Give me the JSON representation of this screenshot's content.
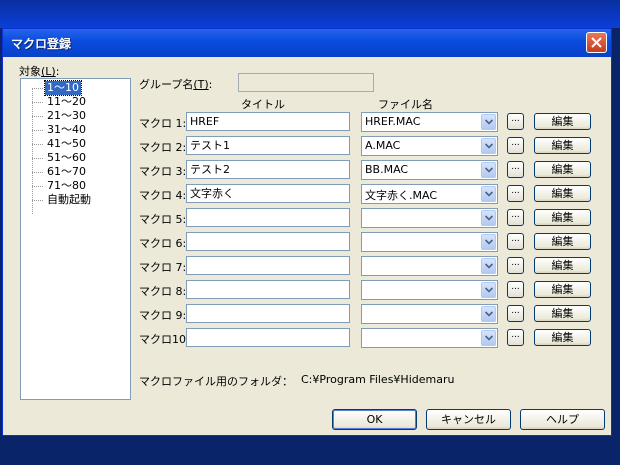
{
  "window": {
    "title": "マクロ登録"
  },
  "target": {
    "label": "対象",
    "accel": "(L)",
    "colon": ":",
    "items": [
      "1～10",
      "11～20",
      "21～30",
      "31～40",
      "41～50",
      "51～60",
      "61～70",
      "71～80",
      "自動起動"
    ],
    "selected": "1～10"
  },
  "group": {
    "label": "グループ名",
    "accel": "(T)",
    "colon": ":",
    "value": ""
  },
  "headers": {
    "title": "タイトル",
    "file": "ファイル名"
  },
  "macros": [
    {
      "label": "マクロ 1:",
      "title": "HREF",
      "file": "HREF.MAC"
    },
    {
      "label": "マクロ 2:",
      "title": "テスト1",
      "file": "A.MAC"
    },
    {
      "label": "マクロ 3:",
      "title": "テスト2",
      "file": "BB.MAC"
    },
    {
      "label": "マクロ 4:",
      "title": "文字赤く",
      "file": "文字赤く.MAC"
    },
    {
      "label": "マクロ 5:",
      "title": "",
      "file": ""
    },
    {
      "label": "マクロ 6:",
      "title": "",
      "file": ""
    },
    {
      "label": "マクロ 7:",
      "title": "",
      "file": ""
    },
    {
      "label": "マクロ 8:",
      "title": "",
      "file": ""
    },
    {
      "label": "マクロ 9:",
      "title": "",
      "file": ""
    },
    {
      "label": "マクロ10:",
      "title": "",
      "file": ""
    }
  ],
  "browse_label": "...",
  "edit_label": "編集",
  "folder": {
    "label": "マクロファイル用のフォルダ：",
    "path": "C:¥Program Files¥Hidemaru"
  },
  "buttons": {
    "ok": "OK",
    "cancel": "キャンセル",
    "help": "ヘルプ"
  }
}
